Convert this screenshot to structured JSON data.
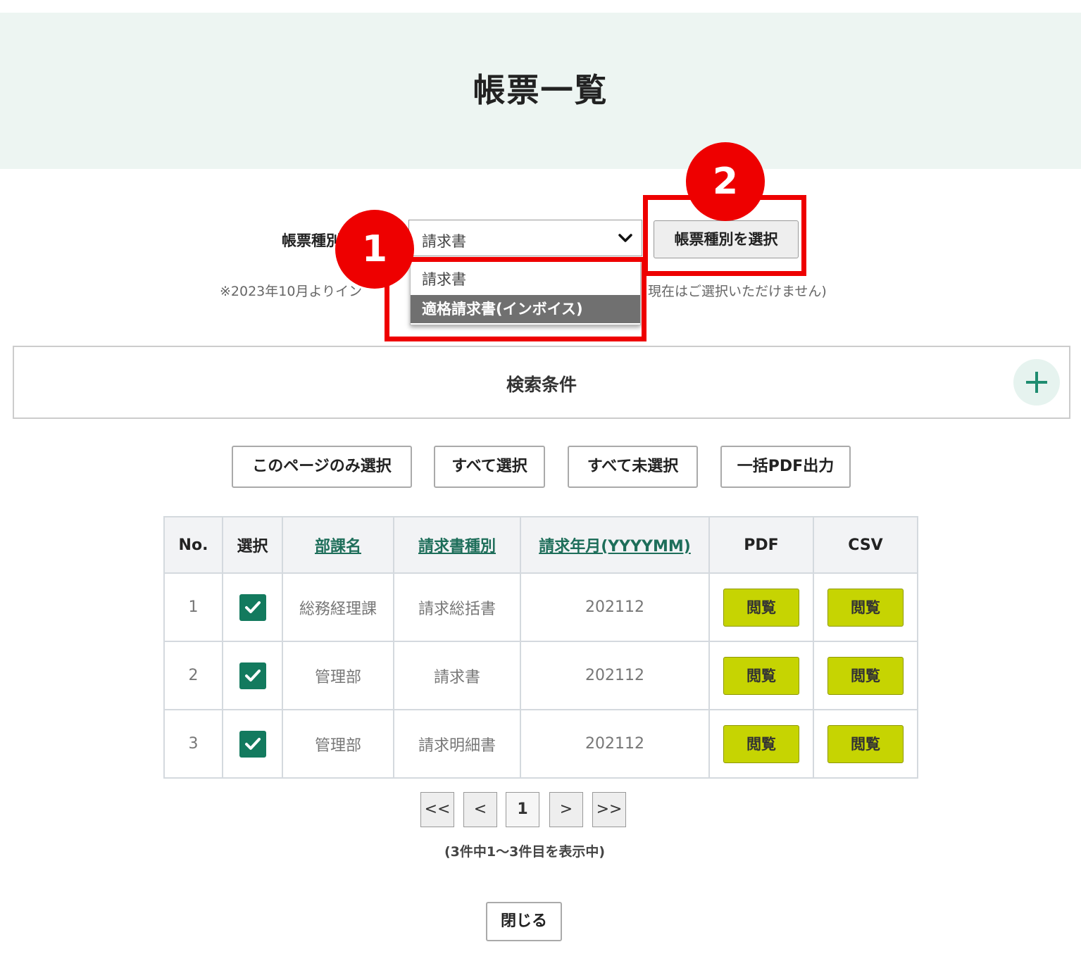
{
  "header": {
    "title": "帳票一覧"
  },
  "form": {
    "label": "帳票種別",
    "select_value": "請求書",
    "options": [
      "請求書",
      "適格請求書(インボイス)"
    ],
    "submit_label": "帳票種別を選択",
    "note_left": "※2023年10月よりイン",
    "note_right": "現在はご選択いただけません)"
  },
  "annotations": {
    "badge1": "1",
    "badge2": "2",
    "highlight_color": "#ee0000"
  },
  "search": {
    "title": "検索条件"
  },
  "actions": [
    "このページのみ選択",
    "すべて選択",
    "すべて未選択",
    "一括PDF出力"
  ],
  "table": {
    "columns": [
      "No.",
      "選択",
      "部課名",
      "請求書種別",
      "請求年月(YYYYMM)",
      "PDF",
      "CSV"
    ],
    "rows": [
      {
        "no": "1",
        "selected": true,
        "dept": "総務経理課",
        "type": "請求総括書",
        "month": "202112",
        "pdf": "閲覧",
        "csv": "閲覧"
      },
      {
        "no": "2",
        "selected": true,
        "dept": "管理部",
        "type": "請求書",
        "month": "202112",
        "pdf": "閲覧",
        "csv": "閲覧"
      },
      {
        "no": "3",
        "selected": true,
        "dept": "管理部",
        "type": "請求明細書",
        "month": "202112",
        "pdf": "閲覧",
        "csv": "閲覧"
      }
    ]
  },
  "pagination": {
    "first": "<<",
    "prev": "<",
    "current": "1",
    "next": ">",
    "last": ">>",
    "info": "(3件中1〜3件目を表示中)"
  },
  "footer": {
    "close_label": "閉じる"
  },
  "colors": {
    "header_bg": "#edf5f2",
    "accent_green": "#137a5e",
    "view_button": "#c6d402"
  }
}
